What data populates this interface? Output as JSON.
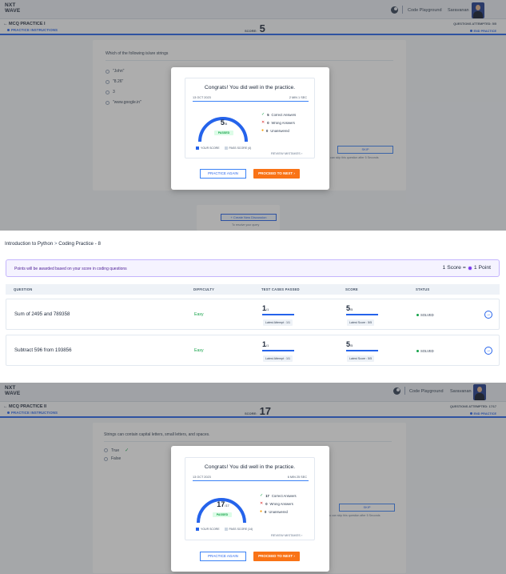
{
  "screen1": {
    "logo_line1": "NXT",
    "logo_line2": "WAVE",
    "nav_code_playground": "Code Playground",
    "nav_user": "Saravanan",
    "practice_title": "← MCQ PRACTICE I",
    "practice_instructions": "PRACTICE INSTRUCTIONS",
    "score_label": "SCORE:",
    "score_value": "5",
    "questions_attempted": "QUESTIONS ATTEMPTED: 5/5",
    "end_practice": "END PRACTICE",
    "question": "Which of the following is/are strings",
    "options": [
      "\"John\"",
      "\"8.26\"",
      "3",
      "\"www.google.in\""
    ],
    "skip_label": "SKIP",
    "skip_hint": "You can skip this question after 5 Seconds",
    "discussion_btn": "+ Create New Discussion",
    "discussion_hint": "To resolve your query",
    "modal": {
      "title": "Congrats! You did well in the practice.",
      "date": "13 OCT 2023",
      "time": "2 MIN 1 SEC",
      "score": "5",
      "score_total": "/5",
      "passed": "PASSED",
      "correct": "5",
      "correct_label": "Correct Answers",
      "wrong": "0",
      "wrong_label": "Wrong Answers",
      "unanswered": "0",
      "unanswered_label": "Unanswered",
      "legend_your": "YOUR SCORE",
      "legend_pass": "PASS SCORE (4)",
      "review": "REVIEW MISTAKES",
      "again": "PRACTICE AGAIN",
      "next": "PROCEED TO NEXT"
    }
  },
  "coding": {
    "crumb_1": "Introduction to Python",
    "crumb_sep": ">",
    "crumb_2": "Coding Practice - 8",
    "banner_text": "Points will be awarded based on your score in coding questions",
    "banner_score": "1 Score =",
    "banner_point": "1 Point",
    "headers": {
      "question": "QUESTION",
      "difficulty": "DIFFICULTY",
      "test_cases": "TEST CASES PASSED",
      "score": "SCORE",
      "status": "STATUS"
    },
    "rows": [
      {
        "question": "Sum of 2495 and 789358",
        "difficulty": "Easy",
        "tests": "1",
        "tests_total": "/1",
        "latest_attempt": "Latest Attempt : 1/1",
        "score": "5",
        "score_total": "/5",
        "latest_score": "Latest Score : 5/5",
        "status": "SOLVED"
      },
      {
        "question": "Subtract 596 from 193856",
        "difficulty": "Easy",
        "tests": "1",
        "tests_total": "/1",
        "latest_attempt": "Latest Attempt : 1/1",
        "score": "5",
        "score_total": "/5",
        "latest_score": "Latest Score : 5/5",
        "status": "SOLVED"
      }
    ]
  },
  "screen2": {
    "logo_line1": "NXT",
    "logo_line2": "WAVE",
    "nav_code_playground": "Code Playground",
    "nav_user": "Saravanan",
    "practice_title": "← MCQ PRACTICE II",
    "practice_instructions": "PRACTICE INSTRUCTIONS",
    "score_label": "SCORE:",
    "score_value": "17",
    "questions_attempted": "QUESTIONS ATTEMPTED: 17/17",
    "end_practice": "END PRACTICE",
    "question": "Strings can contain capital letters, small letters, and spaces.",
    "options": [
      "True",
      "False"
    ],
    "skip_label": "SKIP",
    "skip_hint": "You can skip this question after 5 Seconds",
    "modal": {
      "title": "Congrats! You did well in the practice.",
      "date": "13 OCT 2023",
      "time": "6 MIN 25 SEC",
      "score": "17",
      "score_total": "/17",
      "passed": "PASSED",
      "correct": "17",
      "correct_label": "Correct Answers",
      "wrong": "0",
      "wrong_label": "Wrong Answers",
      "unanswered": "0",
      "unanswered_label": "Unanswered",
      "legend_your": "YOUR SCORE",
      "legend_pass": "PASS SCORE (14)",
      "review": "REVIEW MISTAKES",
      "again": "PRACTICE AGAIN",
      "next": "PROCEED TO NEXT"
    }
  },
  "colors": {
    "accent": "#2563eb",
    "orange": "#f97316",
    "success": "#16a34a",
    "purple": "#7c3aed"
  }
}
